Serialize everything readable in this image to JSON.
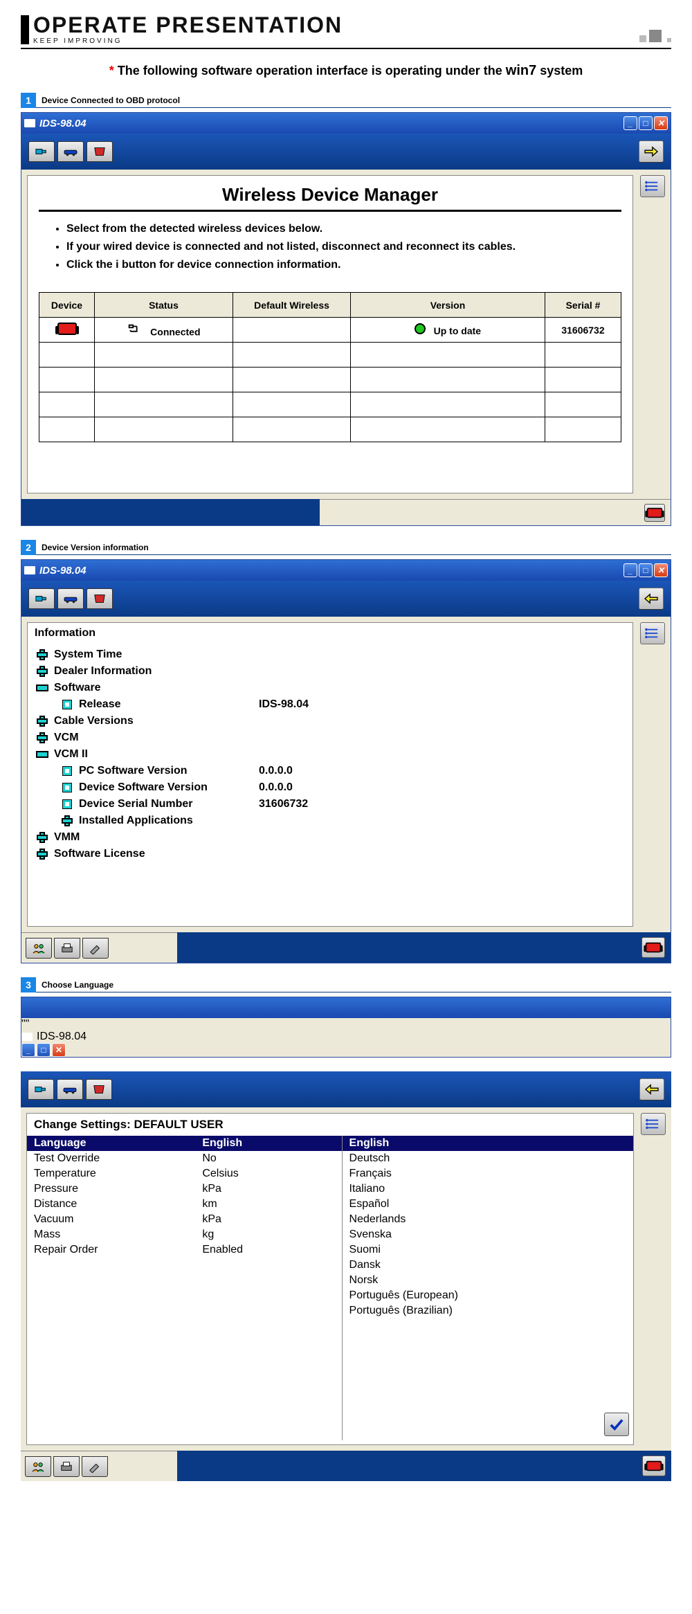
{
  "page_header": {
    "title": "OPERATE PRESENTATION",
    "subtitle": "KEEP IMPROVING"
  },
  "caption": {
    "asterisk": "*",
    "text1": "The following software operation interface is operating under the ",
    "bold": "win7",
    "text2": " system"
  },
  "steps": {
    "s1": {
      "num": "1",
      "label": "Device Connected to OBD protocol"
    },
    "s2": {
      "num": "2",
      "label": "Device Version information"
    },
    "s3": {
      "num": "3",
      "label": "Choose Language"
    }
  },
  "window": {
    "title": "IDS-98.04"
  },
  "panel1": {
    "title": "Wireless Device Manager",
    "bullets": [
      "Select from the detected wireless devices below.",
      "If your wired device is connected and not listed, disconnect and reconnect its cables.",
      "Click the i button for device connection information."
    ],
    "headers": {
      "device": "Device",
      "status": "Status",
      "default": "Default Wireless",
      "version": "Version",
      "serial": "Serial #"
    },
    "row": {
      "status": "Connected",
      "version": "Up to date",
      "serial": "31606732"
    }
  },
  "panel2": {
    "header": "Information",
    "items": {
      "system_time": "System Time",
      "dealer_info": "Dealer Information",
      "software": "Software",
      "release_k": "Release",
      "release_v": "IDS-98.04",
      "cable": "Cable Versions",
      "vcm": "VCM",
      "vcm2": "VCM II",
      "pc_sw_k": "PC Software Version",
      "pc_sw_v": "0.0.0.0",
      "dev_sw_k": "Device Software Version",
      "dev_sw_v": "0.0.0.0",
      "dev_sn_k": "Device Serial Number",
      "dev_sn_v": "31606732",
      "installed": "Installed Applications",
      "vmm": "VMM",
      "license": "Software License"
    }
  },
  "panel3": {
    "header_prefix": "Change Settings:  ",
    "header_user": "DEFAULT USER",
    "left_header_k": "Language",
    "left_header_v": "English",
    "rows": [
      {
        "k": "Test Override",
        "v": "No"
      },
      {
        "k": "Temperature",
        "v": "Celsius"
      },
      {
        "k": "Pressure",
        "v": "kPa"
      },
      {
        "k": "Distance",
        "v": "km"
      },
      {
        "k": "Vacuum",
        "v": "kPa"
      },
      {
        "k": "Mass",
        "v": "kg"
      },
      {
        "k": "Repair Order",
        "v": "Enabled"
      }
    ],
    "right_selected": "English",
    "right_options": [
      "Deutsch",
      "Français",
      "Italiano",
      "Español",
      "Nederlands",
      "Svenska",
      "Suomi",
      "Dansk",
      "Norsk",
      "Português (European)",
      "Português (Brazilian)"
    ]
  }
}
